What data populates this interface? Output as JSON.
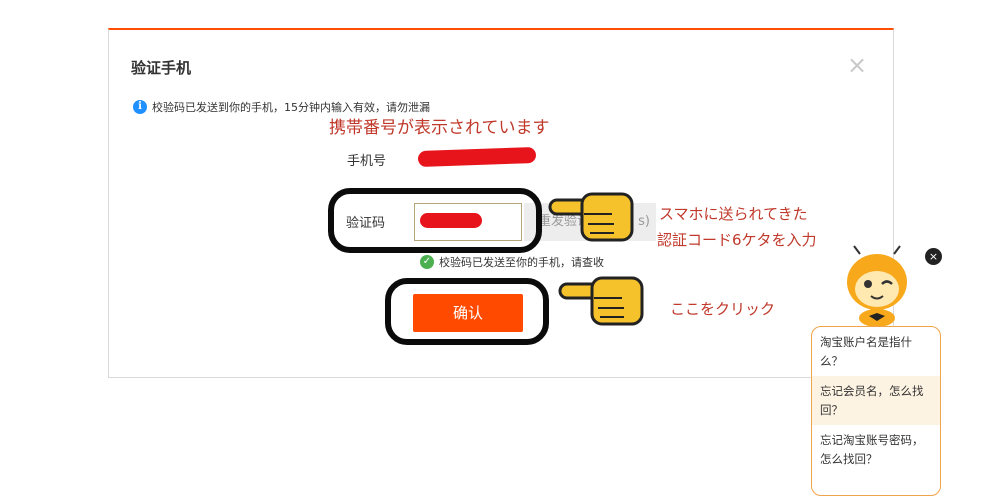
{
  "dialog": {
    "title": "验证手机",
    "close_label": "×",
    "info_text": "校验码已发送到你的手机，15分钟内输入有效，请勿泄漏",
    "phone_label": "手机号",
    "code_label": "验证码",
    "resend_label": "重发验证码(",
    "resend_suffix": "s)",
    "success_text": "校验码已发送至你的手机，请查收",
    "confirm_label": "确认"
  },
  "annotations": {
    "phone_note": "携帯番号が表示されています",
    "code_note_line1": "スマホに送られてきた",
    "code_note_line2": "認証コード6ケタを入力",
    "click_note": "ここをクリック"
  },
  "assistant": {
    "close_label": "×",
    "faq": [
      "淘宝账户名是指什么？",
      "忘记会员名，怎么找回？",
      "忘记淘宝账号密码，怎么找回？"
    ]
  },
  "colors": {
    "accent": "#ff5000",
    "confirm_button": "#ff4a00",
    "annotation_red": "#c0392b",
    "redaction": "#e8141b",
    "info_blue": "#1e90ff",
    "success_green": "#4caf50"
  }
}
